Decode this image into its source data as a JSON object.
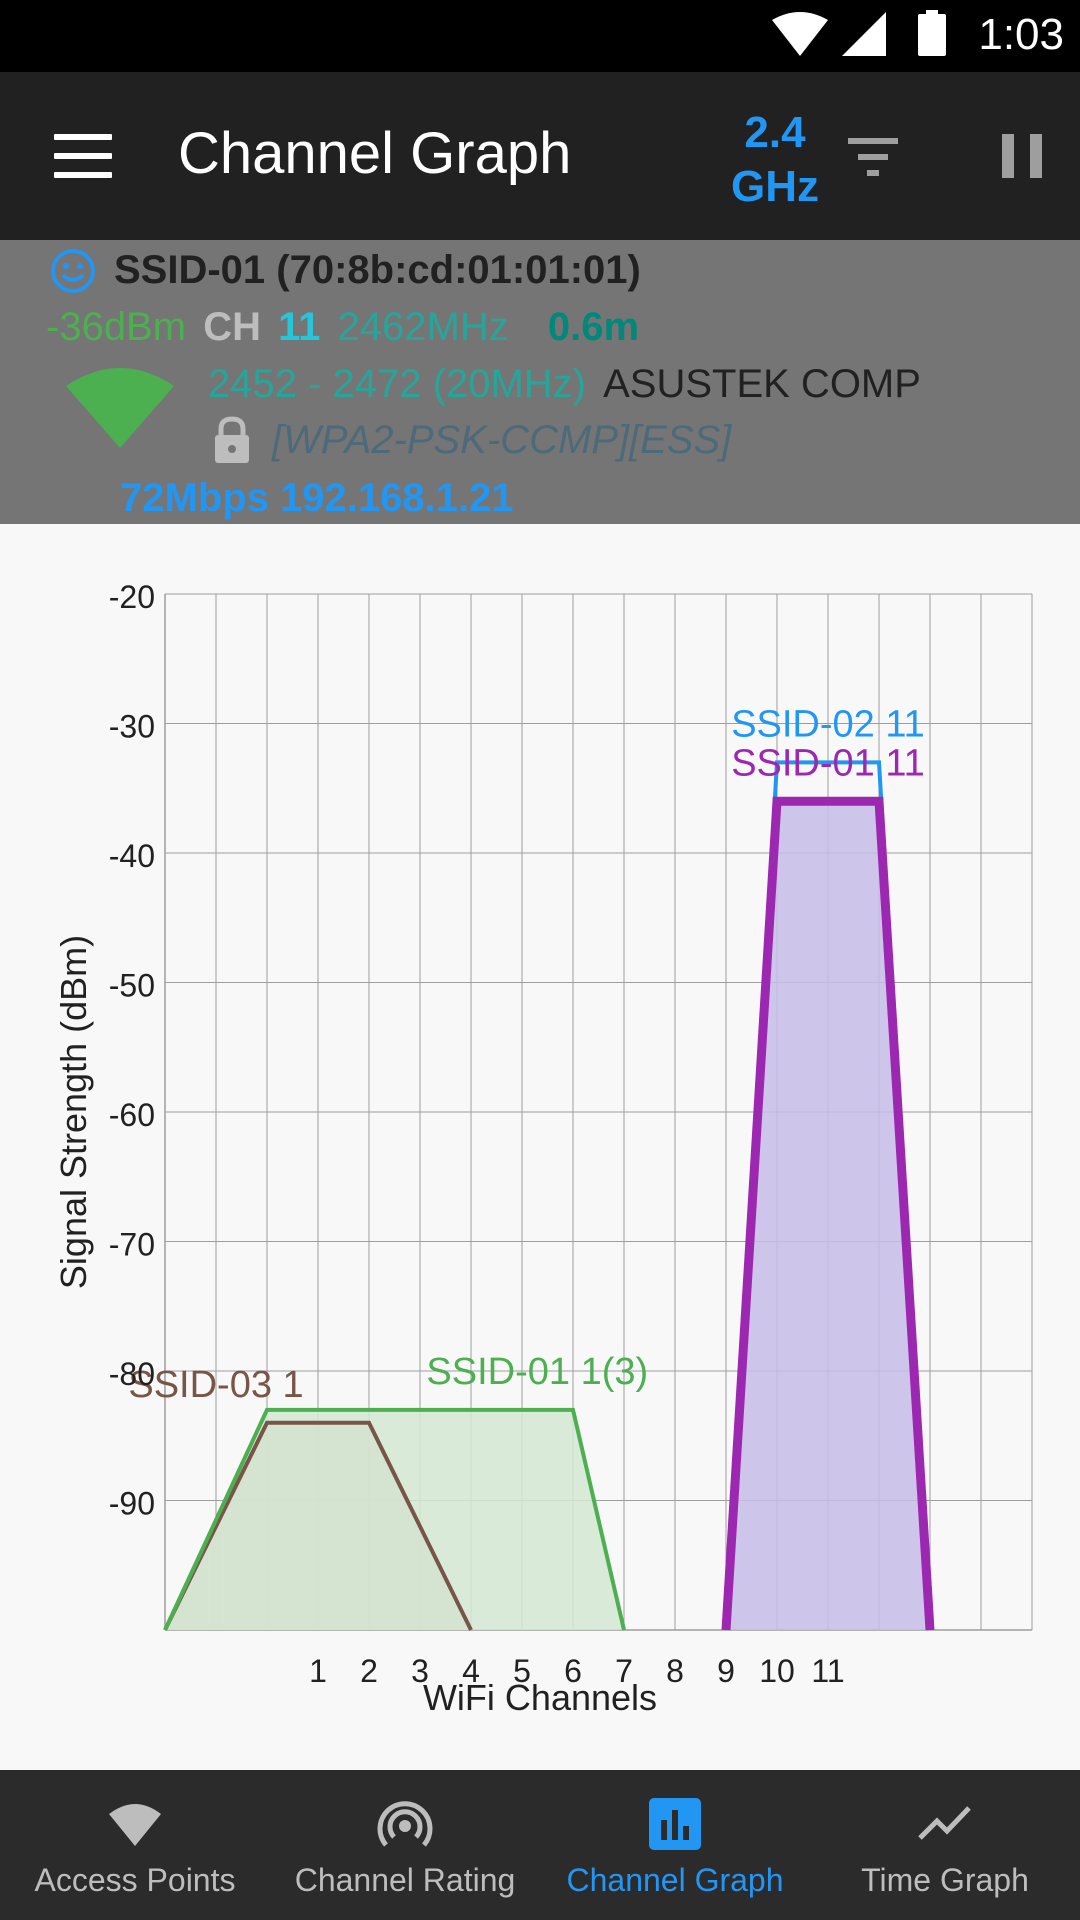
{
  "status_bar": {
    "time": "1:03"
  },
  "app_bar": {
    "title": "Channel Graph",
    "band_value": "2.4",
    "band_unit": "GHz"
  },
  "connection": {
    "ssid_line": "SSID-01 (70:8b:cd:01:01:01)",
    "level": "-36dBm",
    "ch_label": "CH",
    "channel": "11",
    "frequency": "2462MHz",
    "distance": "0.6m",
    "range": "2452 - 2472 (20MHz)",
    "vendor": "ASUSTEK COMP",
    "security": "[WPA2-PSK-CCMP][ESS]",
    "link_info": "72Mbps 192.168.1.21",
    "colors": {
      "level": "#4caf50",
      "channel": "#26c6da",
      "frequency": "#26a69a",
      "distance": "#00897b",
      "range": "#26a69a",
      "wifi_icon": "#4caf50"
    }
  },
  "chart_data": {
    "type": "area",
    "xlabel": "WiFi Channels",
    "ylabel": "Signal Strength (dBm)",
    "ylim": [
      -100,
      -20
    ],
    "yticks": [
      -20,
      -30,
      -40,
      -50,
      -60,
      -70,
      -80,
      -90
    ],
    "xlim": [
      -2,
      15
    ],
    "xticks": [
      1,
      2,
      3,
      4,
      5,
      6,
      7,
      8,
      9,
      10,
      11
    ],
    "grid": true,
    "series": [
      {
        "name": "SSID-03 1",
        "points": [
          [
            -2,
            -100
          ],
          [
            0,
            -84
          ],
          [
            2,
            -84
          ],
          [
            4,
            -100
          ]
        ],
        "color": "#795548",
        "fill": "#c5c8b8",
        "stroke_width": 4,
        "label_at": [
          -1,
          -82
        ]
      },
      {
        "name": "SSID-01 1(3)",
        "points": [
          [
            -2,
            -100
          ],
          [
            0,
            -83
          ],
          [
            6,
            -83
          ],
          [
            7,
            -100
          ]
        ],
        "color": "#4caf50",
        "fill": "#d5e8d4",
        "stroke_width": 4,
        "label_at": [
          5.3,
          -81
        ]
      },
      {
        "name": "SSID-02 11",
        "points": [
          [
            9,
            -100
          ],
          [
            10,
            -33
          ],
          [
            12,
            -33
          ],
          [
            13,
            -100
          ]
        ],
        "color": "#2196f3",
        "fill": "none",
        "stroke_width": 4,
        "label_at": [
          11,
          -31
        ]
      },
      {
        "name": "SSID-01 11",
        "points": [
          [
            9,
            -100
          ],
          [
            10,
            -36
          ],
          [
            12,
            -36
          ],
          [
            13,
            -100
          ]
        ],
        "color": "#9c27b0",
        "fill": "#c5bde8",
        "stroke_width": 9,
        "label_at": [
          11,
          -34
        ]
      }
    ]
  },
  "bottom_nav": {
    "items": [
      {
        "label": "Access Points",
        "icon": "wifi-icon"
      },
      {
        "label": "Channel Rating",
        "icon": "wifi-tethering-icon"
      },
      {
        "label": "Channel Graph",
        "icon": "bar-chart-icon",
        "active": true
      },
      {
        "label": "Time Graph",
        "icon": "line-chart-icon"
      }
    ]
  }
}
